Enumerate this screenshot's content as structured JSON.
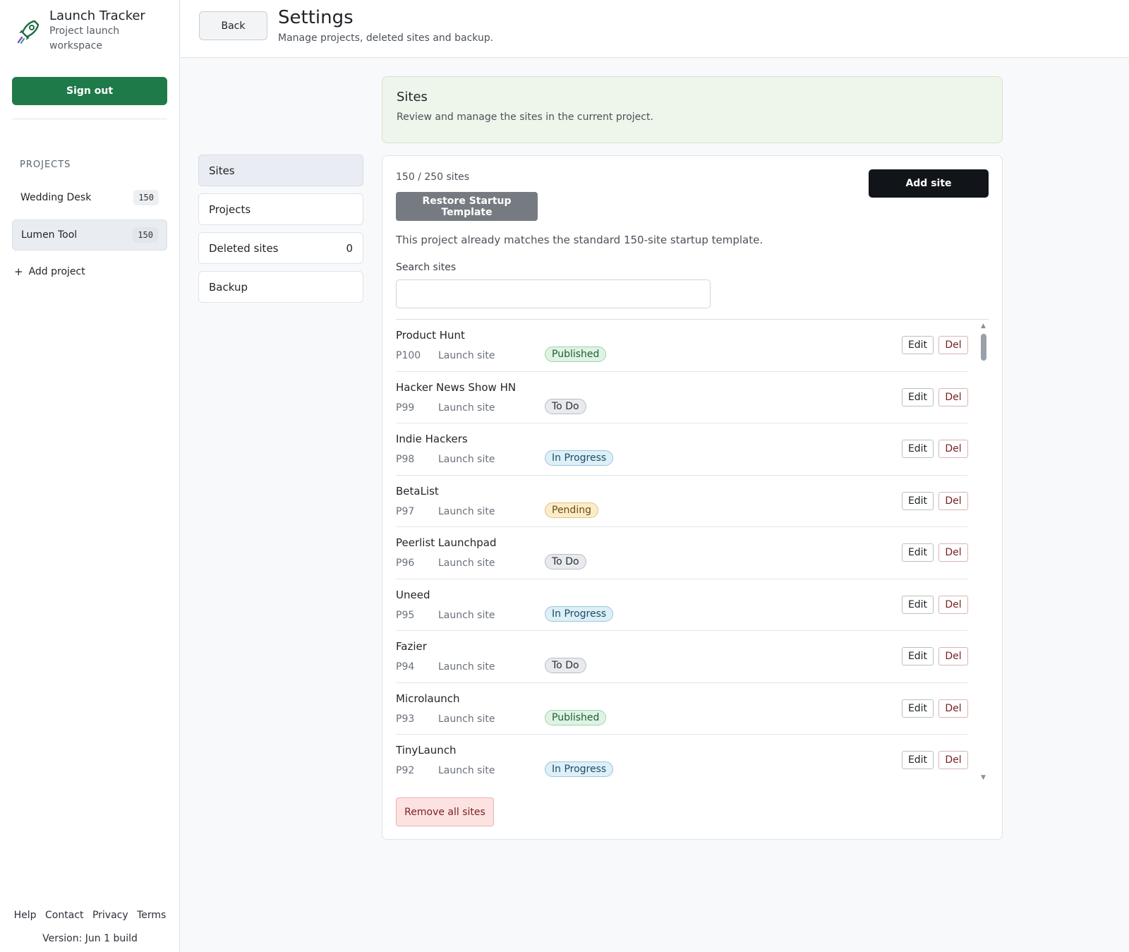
{
  "brand": {
    "title": "Launch Tracker",
    "subtitle": "Project launch workspace",
    "logo_icon": "rocket-icon"
  },
  "sidebar": {
    "signout_label": "Sign out",
    "projects_heading": "PROJECTS",
    "projects": [
      {
        "name": "Wedding Desk",
        "count": "150",
        "active": false
      },
      {
        "name": "Lumen Tool",
        "count": "150",
        "active": true
      }
    ],
    "add_project_label": "Add project",
    "footer_links": [
      "Help",
      "Contact",
      "Privacy",
      "Terms"
    ],
    "version": "Version: Jun 1 build"
  },
  "header": {
    "back_label": "Back",
    "title": "Settings",
    "subtitle": "Manage projects, deleted sites and backup."
  },
  "settings_nav": {
    "sites": "Sites",
    "projects": "Projects",
    "deleted_sites": "Deleted sites",
    "deleted_count": "0",
    "backup": "Backup"
  },
  "info": {
    "title": "Sites",
    "text": "Review and manage the sites in the current project."
  },
  "sites": {
    "count_text": "150 / 250 sites",
    "add_label": "Add site",
    "restore_label": "Restore Startup Template",
    "template_note": "This project already matches the standard 150-site startup template.",
    "search_label": "Search sites",
    "search_value": "",
    "edit_label": "Edit",
    "del_label": "Del",
    "remove_all_label": "Remove all sites",
    "rows": [
      {
        "name": "Product Hunt",
        "id": "P100",
        "type": "Launch site",
        "status": "Published",
        "status_key": "published"
      },
      {
        "name": "Hacker News Show HN",
        "id": "P99",
        "type": "Launch site",
        "status": "To Do",
        "status_key": "todo"
      },
      {
        "name": "Indie Hackers",
        "id": "P98",
        "type": "Launch site",
        "status": "In Progress",
        "status_key": "progress"
      },
      {
        "name": "BetaList",
        "id": "P97",
        "type": "Launch site",
        "status": "Pending",
        "status_key": "pending"
      },
      {
        "name": "Peerlist Launchpad",
        "id": "P96",
        "type": "Launch site",
        "status": "To Do",
        "status_key": "todo"
      },
      {
        "name": "Uneed",
        "id": "P95",
        "type": "Launch site",
        "status": "In Progress",
        "status_key": "progress"
      },
      {
        "name": "Fazier",
        "id": "P94",
        "type": "Launch site",
        "status": "To Do",
        "status_key": "todo"
      },
      {
        "name": "Microlaunch",
        "id": "P93",
        "type": "Launch site",
        "status": "Published",
        "status_key": "published"
      },
      {
        "name": "TinyLaunch",
        "id": "P92",
        "type": "Launch site",
        "status": "In Progress",
        "status_key": "progress"
      }
    ]
  },
  "colors": {
    "accent_green": "#1f7a4a",
    "dark_button": "#111418",
    "info_bg": "#eef5ea"
  }
}
